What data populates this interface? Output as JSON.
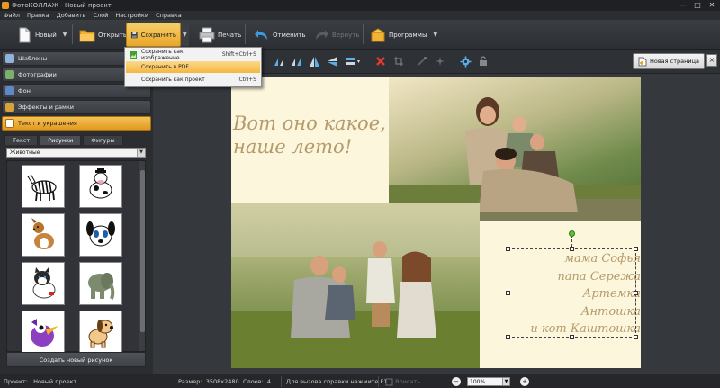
{
  "window": {
    "title": "ФотоКОЛЛАЖ - Новый проект",
    "controls": [
      "—",
      "□",
      "✕"
    ]
  },
  "menu": [
    "Файл",
    "Правка",
    "Добавить",
    "Слой",
    "Настройки",
    "Справка"
  ],
  "toolbar": {
    "new_label": "Новый",
    "open_label": "Открыть",
    "save_label": "Сохранить",
    "print_label": "Печать",
    "undo_label": "Отменить",
    "redo_label": "Вернуть",
    "programs_label": "Программы"
  },
  "save_menu": {
    "items": [
      {
        "label": "Сохранить как изображение...",
        "shortcut": "Shift+Ctrl+S",
        "icon": "image-save-icon"
      },
      {
        "label": "Сохранить в PDF",
        "shortcut": "",
        "icon": "pdf-icon"
      },
      {
        "label": "Сохранить как проект",
        "shortcut": "Ctrl+S",
        "icon": "project-icon"
      }
    ],
    "highlighted_index": 1
  },
  "left_panel": {
    "sections": [
      {
        "label": "Шаблоны",
        "icon": "templates-icon",
        "active": false
      },
      {
        "label": "Фотографии",
        "icon": "photos-icon",
        "active": false
      },
      {
        "label": "Фон",
        "icon": "background-icon",
        "active": false
      },
      {
        "label": "Эффекты и рамки",
        "icon": "effects-icon",
        "active": false
      },
      {
        "label": "Текст и украшения",
        "icon": "text-decor-icon",
        "active": true
      }
    ],
    "tabs": [
      "Текст",
      "Рисунки",
      "Фигуры"
    ],
    "active_tab": "Рисунки",
    "category": "Животные",
    "clipart": [
      "zebra",
      "cow",
      "collie-dog",
      "dalmatian-puppy",
      "husky-puppy",
      "elephant",
      "purple-bird",
      "cartoon-dog"
    ],
    "create_button": "Создать новый рисунок"
  },
  "subbar": {
    "new_page_label": "Новая страница",
    "close_label": "×"
  },
  "canvas": {
    "headline": [
      "Вот оно какое,",
      "наше лето!"
    ],
    "names": [
      "мама Софья",
      "папа Сережа",
      "Артемка",
      "Антошка",
      "и кот Каштошка"
    ]
  },
  "status": {
    "project_label": "Проект:",
    "project_name": "Новый проект",
    "size_label": "Размер:",
    "size_value": "3508x2480",
    "layers_label": "Слоев:",
    "layers_value": "4",
    "help_text": "Для вызова справки нажмите F1.",
    "fit_label": "Вписать",
    "zoom_value": "100%",
    "zoom_out": "−",
    "zoom_in": "+"
  },
  "colors": {
    "accent": "#e9a628",
    "canvas_bg": "#fcf6dc",
    "script_text": "#b49a6c",
    "chrome": "#2f3236"
  }
}
